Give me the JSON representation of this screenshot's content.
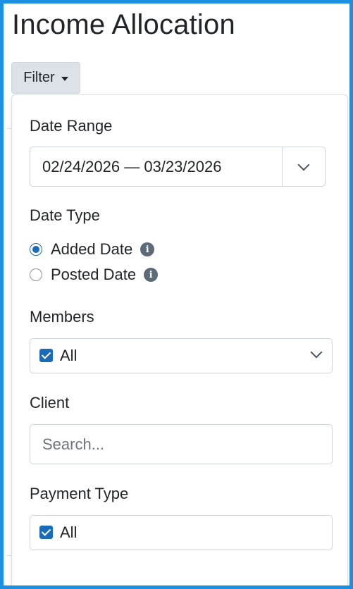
{
  "page": {
    "title": "Income Allocation"
  },
  "filter": {
    "button_label": "Filter"
  },
  "date_range": {
    "label": "Date Range",
    "value": "02/24/2026 — 03/23/2026"
  },
  "date_type": {
    "label": "Date Type",
    "options": [
      {
        "label": "Added Date",
        "selected": true
      },
      {
        "label": "Posted Date",
        "selected": false
      }
    ],
    "info_glyph": "i"
  },
  "members": {
    "label": "Members",
    "value": "All",
    "checked": true
  },
  "client": {
    "label": "Client",
    "placeholder": "Search...",
    "value": ""
  },
  "payment_type": {
    "label": "Payment Type",
    "value": "All",
    "checked": true
  },
  "colors": {
    "accent": "#1a6bb8",
    "frame_border": "#1c8fe0",
    "filter_button_bg": "#dde2e8",
    "info_icon_bg": "#5d6b78"
  },
  "icons": {
    "filter_caret": "caret-down-icon",
    "date_toggle": "chevron-down-icon",
    "info": "info-icon",
    "select_toggle": "chevron-down-icon"
  }
}
